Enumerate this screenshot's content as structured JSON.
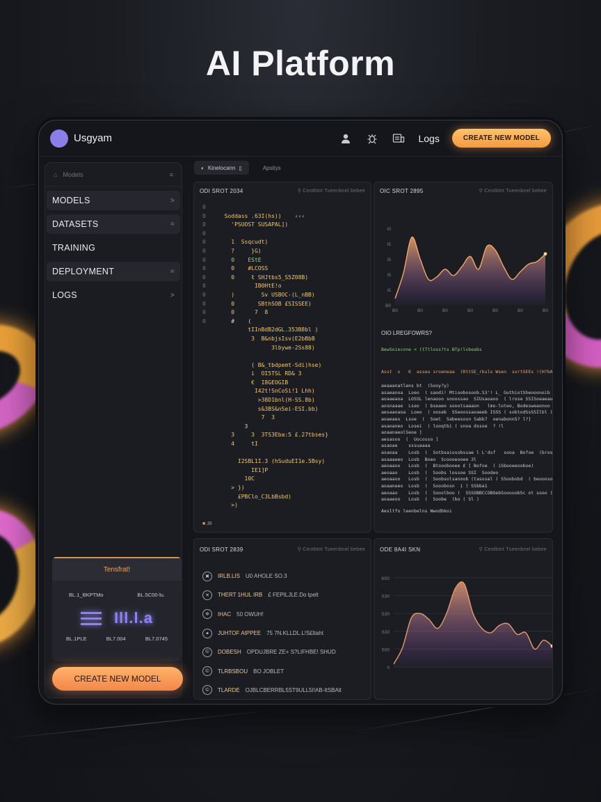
{
  "page": {
    "title": "AI Platform"
  },
  "topbar": {
    "brand": "Usgyam",
    "logs_label": "Logs",
    "create_label": "CREATE NEW MODEL",
    "icons": [
      "user-icon",
      "bug-icon",
      "inbox-icon"
    ]
  },
  "sidebar": {
    "header_label": "Models",
    "items": [
      {
        "label": "MODELS",
        "marker": ">"
      },
      {
        "label": "DATASETS",
        "marker": "="
      },
      {
        "label": "TRAINING",
        "marker": ""
      },
      {
        "label": "DEPLOYMENT",
        "marker": "="
      },
      {
        "label": "LOGS",
        "marker": ">"
      }
    ],
    "promo": {
      "title": "Tensfrat!",
      "row1_left": "BL.1_BKPTMo",
      "row1_right": "BL.5C00-lu.",
      "big_text": "Ill.l.a",
      "row2_left": "BL.1PLE",
      "row2_mid": "BL7.004",
      "row2_right": "BL7.0745"
    },
    "create_label": "CREATE NEW MODEL"
  },
  "tabs": [
    {
      "label": "Kinelocann"
    },
    {
      "label": "Apstiys"
    }
  ],
  "code_panel": {
    "title": "ODI SROT 2034",
    "meta": "Ceotbtnt Tueenbnel bebee",
    "lines": [
      {
        "n": "0",
        "t": "",
        "c": "c-w"
      },
      {
        "n": "0",
        "t": "  Soddass .63I(hs))    ‹‹‹",
        "c": "c-y"
      },
      {
        "n": "0",
        "t": "    'PSUOST SUSAPAL])",
        "c": "c-y"
      },
      {
        "n": "0",
        "t": "",
        "c": "c-w"
      },
      {
        "n": "0",
        "t": "    1  Ssqcudt)",
        "c": "c-y"
      },
      {
        "n": "0",
        "t": "    ?     }G)",
        "c": "c-y"
      },
      {
        "n": "0",
        "t": "    0    EStE",
        "c": "c-g"
      },
      {
        "n": "0",
        "t": "    0    #LCOSS",
        "c": "c-y"
      },
      {
        "n": "0",
        "t": "    0     ł SHJtbs5_S5Z08B)",
        "c": "c-y"
      },
      {
        "n": "0",
        "t": "           IB0HtE!o",
        "c": "c-y"
      },
      {
        "n": "0",
        "t": "    )        Sv USBOC-(L_nBB)",
        "c": "c-y"
      },
      {
        "n": "0",
        "t": "    0       SBthSOB £SISSEE)",
        "c": "c-y"
      },
      {
        "n": "0",
        "t": "    0      7  8",
        "c": "c-y"
      },
      {
        "n": "0",
        "t": "    #    (",
        "c": "c-w"
      },
      {
        "n": "",
        "t": "         tIInBdB2dGL.353B8bl )",
        "c": "c-y"
      },
      {
        "n": "",
        "t": "          3  B&nbjsIsv(E2bBbB",
        "c": "c-y"
      },
      {
        "n": "",
        "t": "                3lbywe-2Ss88)",
        "c": "c-y"
      },
      {
        "n": "",
        "t": "",
        "c": "c-w"
      },
      {
        "n": "",
        "t": "          ( B&_tbdpemt-Sdi)hse)",
        "c": "c-y"
      },
      {
        "n": "",
        "t": "          i  OI5TSL RD& 3",
        "c": "c-y"
      },
      {
        "n": "",
        "t": "          €  I8GEOGIB",
        "c": "c-y"
      },
      {
        "n": "",
        "t": "           I42t!SnCoSi!1 Lhh)",
        "c": "c-y"
      },
      {
        "n": "",
        "t": "            >38D1bnl(H-SS.8b)",
        "c": "c-y"
      },
      {
        "n": "",
        "t": "            s&3BS&nSei-ESI.bb)",
        "c": "c-y"
      },
      {
        "n": "",
        "t": "             7  3",
        "c": "c-y"
      },
      {
        "n": "",
        "t": "        3",
        "c": "c-w"
      },
      {
        "n": "",
        "t": "    3     3  3TS3Eba:5 £.27tbses}",
        "c": "c-y"
      },
      {
        "n": "",
        "t": "    4     tI",
        "c": "c-y"
      },
      {
        "n": "",
        "t": "",
        "c": "c-w"
      },
      {
        "n": "",
        "t": "      I2SBL1I.3 (hSuduEI1e.5Bsy)",
        "c": "c-y"
      },
      {
        "n": "",
        "t": "          IE1]P",
        "c": "c-y"
      },
      {
        "n": "",
        "t": "        10C",
        "c": "c-y"
      },
      {
        "n": "",
        "t": "    > })",
        "c": "c-y"
      },
      {
        "n": "",
        "t": "      £PBClo_C3LbBsbd)",
        "c": "c-y"
      },
      {
        "n": "",
        "t": "    >)",
        "c": "c-y"
      }
    ],
    "footer": "■ J8"
  },
  "chart_top": {
    "title": "OIC SROT 2895",
    "meta": "Ceotbtnt Tueenbnel bebee"
  },
  "log_panel": {
    "title": "OIO LREGFOWRS?",
    "line1": "BewSoiecone < (tTtloss?ts BTp!lvbeabs",
    "line2": "Asst  x   K  asseu sroeneaa  (RttSE_rkslx Wsen  sxrtSEEs !(H?bAoor)",
    "lines": [
      "aeaaanatlens bt  (5ooy?y)",
      "asaeanoa  Loeo  ( saodi! Mtioobosoob.S3'! L_ GuthiotSheooonoib )",
      "aoaaeaoa  LOSSL lenaooo sooossao  SIUsaoaoo  ( lrose SSISoeaeau",
      "aosnaaae  Lseo  ( bseaeo soootsaaaon   lmo-loteo, Bodesweaonoo lo)",
      "aesaaoaoa  Loeo  ( ooseb  SSeoossaoaeeb ISSS ( sobtodSsSSIlbl )",
      "aoaeaes  Lsoe  (  Soet  Sabeesosn Sabb7  oenabonnS? l?]",
      "asaoaneo  Losei  ( looqtbi ( snoa dssoe  ? !l",
      "aoaanaeolSeoe ]",
      "aesasoo  (  Uocosso ]",
      "asaoae    sssuaaaa",
      "asaoaa    Losb  (  Sotbsaiosobssae l L'dsf   sooa  Bofoe  (brosdSoooeaoae)",
      "asaaaeeo  Losb  Boeo  Scoooeooee 3l",
      "aeoaaoo   Losb  (  Btooobooee £ [ Bofoe  ( iSbooeeooboe)",
      "aeoaao    Losb  (  Soobs lossoe SSI  Soodeo",
      "aeoaaoo   Losb  (  Soobsolsanoob (tasosel ( SSoobsbd  ( beooosooo-oo)",
      "aoaaneeo  Losb  (  Sooobosn  i ( SSbba1",
      "aeoaao    Losb  (  Sooolboo (  SSSOBBCCOBOebSooooobSc ot sooo )",
      "aoaaeoo   Losb  (  Soobe  (bo ( Sl )"
    ],
    "footer": "Aesltfo leenbelns Wwodbkoi"
  },
  "list_panel": {
    "title": "ODI SROT 2839",
    "meta": "Ceotbtnt Tueenbnel bebee",
    "items": [
      {
        "icon": "✖",
        "head": "IRLB.LIS",
        "rest": "U0 AHOLE SO.3"
      },
      {
        "icon": "✕",
        "head": "THERT 1HUL IRB",
        "rest": "£ FEPILJLE.Do tpelt"
      },
      {
        "icon": "❈",
        "head": "IHAC",
        "rest": "50 OWUH!"
      },
      {
        "icon": "✦",
        "head": "JUHTOF AIPPEE",
        "rest": "75 7N.KLLDL.L!S£ltaht"
      },
      {
        "icon": "©",
        "head": "DOBESH",
        "rest": "OPDUJBRE ZE+ S?LIFHBE! SHUD"
      },
      {
        "icon": "©",
        "head": "TLRBSBOU",
        "rest": "BO JOBLET"
      },
      {
        "icon": "©",
        "head": "TLARDE",
        "rest": "OJBLCBERRBL5ST9ULL5I!AB-ItSBAlt"
      }
    ]
  },
  "chart_bottom": {
    "title": "ODE 8A4I SKN",
    "meta": "Ceotbtnt Tueenbnel bebee"
  },
  "chart_data": [
    {
      "type": "area",
      "title": "OIC SROT 2895",
      "xlabel": "",
      "ylabel": "",
      "x_ticks": [
        "B0",
        "B0",
        "B0",
        "B0",
        "B0",
        "B0",
        "B0"
      ],
      "y_ticks": [
        "I0",
        "I5",
        "I5",
        "I5",
        "I5",
        "B0"
      ],
      "ylim": [
        0,
        6
      ],
      "x": [
        0,
        1,
        2,
        3,
        4,
        5,
        6,
        7,
        8,
        9,
        10,
        11,
        12,
        13,
        14,
        15,
        16,
        17,
        18
      ],
      "series": [
        {
          "values": [
            0.5,
            2.5,
            5.3,
            3.6,
            2.0,
            2.2,
            2.8,
            2.3,
            3.0,
            3.8,
            2.8,
            4.6,
            4.3,
            3.0,
            2.0,
            2.6,
            3.2,
            3.4,
            4.0
          ]
        }
      ],
      "grid": false,
      "color": "#f2a866"
    },
    {
      "type": "area",
      "title": "ODE 8A4I SKN",
      "xlabel": "",
      "ylabel": "",
      "y_ticks": [
        "6S0",
        "S30",
        "S30",
        "S30",
        "S00",
        "0"
      ],
      "ylim": [
        0,
        6
      ],
      "x": [
        0,
        1,
        2,
        3,
        4,
        5,
        6,
        7,
        8,
        9,
        10,
        11,
        12,
        13,
        14,
        15,
        16,
        17,
        18
      ],
      "series": [
        {
          "values": [
            0.2,
            1.3,
            3.3,
            3.6,
            3.2,
            2.6,
            3.6,
            5.3,
            5.6,
            3.6,
            2.6,
            2.3,
            2.8,
            2.9,
            2.2,
            2.3,
            1.2,
            1.8,
            1.4
          ]
        }
      ],
      "grid": true,
      "color": "#e49b6c"
    }
  ]
}
